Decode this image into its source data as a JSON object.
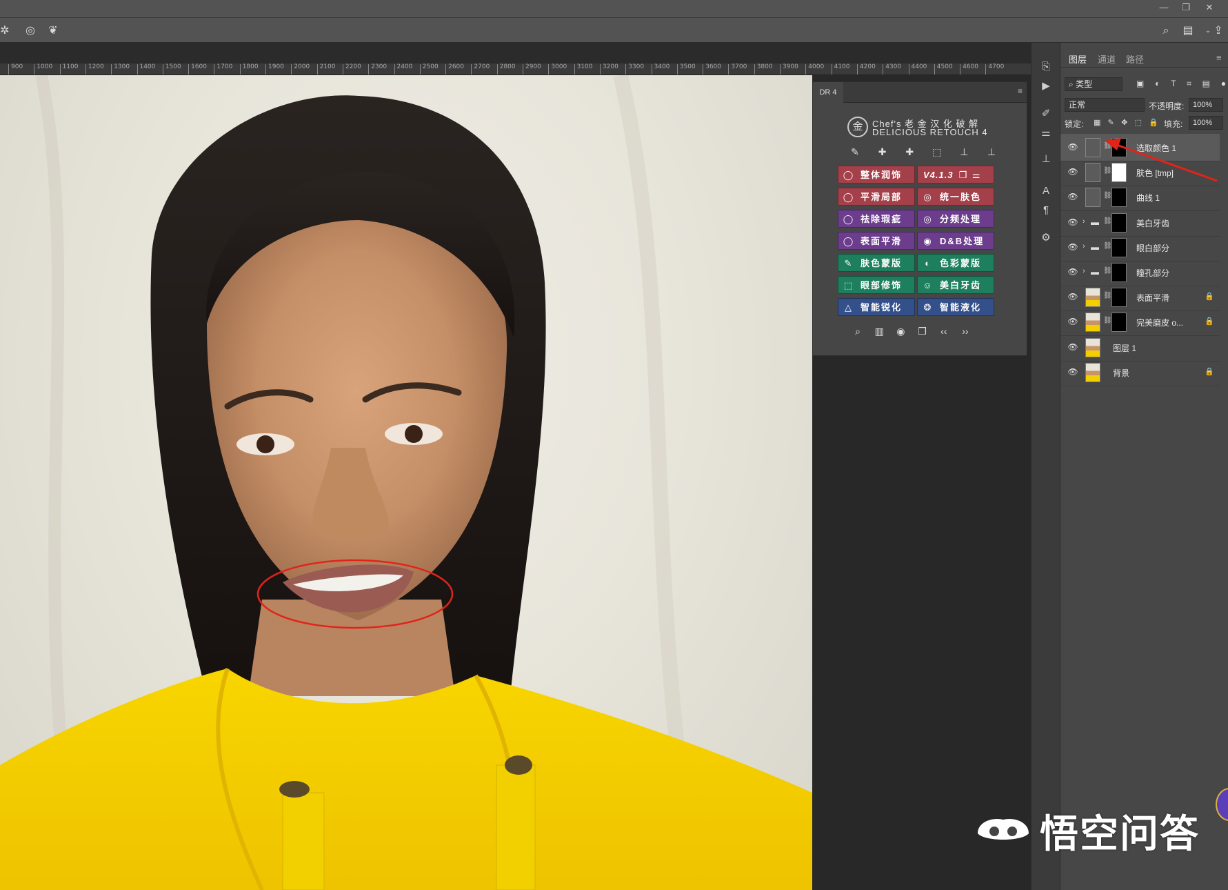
{
  "options_bar": {
    "icons": [
      "gear-icon",
      "brush-target-icon",
      "butterfly-icon",
      "search-icon",
      "workspace-icon",
      "share-icon"
    ]
  },
  "ruler": {
    "ticks": [
      "900",
      "1000",
      "1100",
      "1200",
      "1300",
      "1400",
      "1500",
      "1600",
      "1700",
      "1800",
      "1900",
      "2000",
      "2100",
      "2200",
      "2300",
      "2400",
      "2500",
      "2600",
      "2700",
      "2800",
      "2900",
      "3000",
      "3100",
      "3200",
      "3300",
      "3400",
      "3500",
      "3600",
      "3700",
      "3800",
      "3900",
      "4000",
      "4100",
      "4200",
      "4300",
      "4400",
      "4500",
      "4600",
      "4700"
    ]
  },
  "dr4": {
    "tab_label": "DR 4",
    "logo_char": "金",
    "title_line1": "Chef's 老 金 汉 化 破 解",
    "title_line2": "DELICIOUS RETOUCH 4",
    "buttons": [
      {
        "label": "整体润饰",
        "color": "red"
      },
      {
        "label": "V4.1.3",
        "color": "red"
      },
      {
        "label": "平滑局部",
        "color": "red"
      },
      {
        "label": "统一肤色",
        "color": "red"
      },
      {
        "label": "祛除瑕疵",
        "color": "purple"
      },
      {
        "label": "分频处理",
        "color": "purple"
      },
      {
        "label": "表面平滑",
        "color": "purple"
      },
      {
        "label": "D&B处理",
        "color": "purple"
      },
      {
        "label": "肤色蒙版",
        "color": "teal"
      },
      {
        "label": "色彩蒙版",
        "color": "teal"
      },
      {
        "label": "眼部修饰",
        "color": "teal"
      },
      {
        "label": "美白牙齿",
        "color": "teal"
      },
      {
        "label": "智能锐化",
        "color": "blue"
      },
      {
        "label": "智能液化",
        "color": "blue"
      }
    ],
    "nav_left": "‹‹",
    "nav_right": "››"
  },
  "layers_panel": {
    "tabs": [
      "图层",
      "通道",
      "路径"
    ],
    "filter_kind": "类型",
    "blend_mode": "正常",
    "opacity_label": "不透明度:",
    "opacity_value": "100%",
    "lock_label": "锁定:",
    "fill_label": "填充:",
    "fill_value": "100%",
    "layers": [
      {
        "name": "选取颜色 1",
        "thumb": "adjust",
        "mask": "black",
        "selected": true,
        "locked": false
      },
      {
        "name": "肤色 [tmp]",
        "thumb": "adjust",
        "mask": "white",
        "selected": false,
        "locked": false
      },
      {
        "name": "曲线 1",
        "thumb": "adjust",
        "mask": "black",
        "selected": false,
        "locked": false
      },
      {
        "name": "美白牙齿",
        "thumb": "folder",
        "mask": "black",
        "selected": false,
        "locked": false
      },
      {
        "name": "眼白部分",
        "thumb": "folder",
        "mask": "black",
        "selected": false,
        "locked": false
      },
      {
        "name": "瞳孔部分",
        "thumb": "folder",
        "mask": "black",
        "selected": false,
        "locked": false
      },
      {
        "name": "表面平滑",
        "thumb": "photo",
        "mask": "black",
        "selected": false,
        "locked": true
      },
      {
        "name": "完美磨皮 o...",
        "thumb": "photo",
        "mask": "black",
        "selected": false,
        "locked": true
      },
      {
        "name": "图层 1",
        "thumb": "photo",
        "mask": "",
        "selected": false,
        "locked": false
      },
      {
        "name": "背景",
        "thumb": "photo",
        "mask": "",
        "selected": false,
        "locked": true
      }
    ]
  },
  "watermark": {
    "text": "悟空问答"
  },
  "colors": {
    "ui_bg": "#535353",
    "panel_bg": "#474747",
    "annotation_red": "#e2231a",
    "shirt_yellow": "#f6cf00"
  }
}
